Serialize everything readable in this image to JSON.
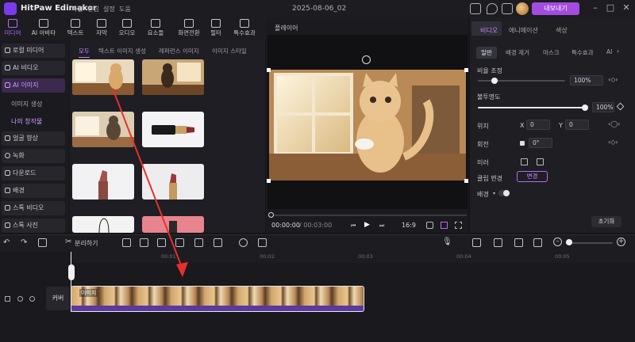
{
  "app": {
    "name": "HitPaw Edimakor",
    "project": "2025-08-06_02",
    "export_label": "내보내기"
  },
  "menu": [
    "파일",
    "편집",
    "설정",
    "도움"
  ],
  "toolbar": [
    {
      "label": "미디어",
      "icon": "media-icon",
      "active": true
    },
    {
      "label": "AI 아바타",
      "icon": "avatar-icon"
    },
    {
      "label": "텍스트",
      "icon": "text-icon"
    },
    {
      "label": "자막",
      "icon": "subtitle-icon"
    },
    {
      "label": "오디오",
      "icon": "audio-icon"
    },
    {
      "label": "요소들",
      "icon": "elements-icon"
    },
    {
      "label": "화면전환",
      "icon": "transition-icon"
    },
    {
      "label": "필터",
      "icon": "filter-icon"
    },
    {
      "label": "특수효과",
      "icon": "effects-icon"
    }
  ],
  "sidebar": {
    "items": [
      {
        "label": "로컬 미디어",
        "icon": "folder-icon"
      },
      {
        "label": "AI 비디오",
        "icon": "ai-video-icon"
      },
      {
        "label": "AI 이미지",
        "icon": "ai-image-icon",
        "active": true
      },
      {
        "label": "얼굴 향상",
        "icon": "face-icon"
      },
      {
        "label": "녹화",
        "icon": "record-icon"
      },
      {
        "label": "다운로드",
        "icon": "download-icon"
      },
      {
        "label": "배경",
        "icon": "background-icon"
      },
      {
        "label": "스톡 비디오",
        "icon": "stock-video-icon"
      },
      {
        "label": "스톡 사진",
        "icon": "stock-photo-icon"
      }
    ],
    "subitems": [
      "이미지 생성",
      "나의 창작물"
    ]
  },
  "media": {
    "tabs": [
      "모두",
      "텍스트 이미지 생성",
      "레퍼런스 이미지",
      "이미지 스타일"
    ]
  },
  "preview": {
    "title": "플레이어",
    "time_current": "00:00:00",
    "time_total": "/ 00:03:00",
    "ratio": "16:9"
  },
  "right": {
    "tabs": [
      "비디오",
      "애니메이션",
      "색상"
    ],
    "subtabs": [
      "일반",
      "배경 제거",
      "마스크",
      "특수효과",
      "AI"
    ],
    "scale_label": "비율 조정",
    "scale_value": "100%",
    "scale_level": 0.05,
    "opacity_label": "불투명도",
    "opacity_value": "100%",
    "opacity_level": 1.0,
    "position_label": "위치",
    "x_label": "X",
    "x_value": "0",
    "y_label": "Y",
    "y_value": "0",
    "rotate_label": "회전",
    "rotate_value": "0°",
    "flip_label": "미러",
    "bg_label": "클립 변경",
    "bg_button": "변경",
    "bg_toggle_label": "배경",
    "reset_label": "초기화"
  },
  "timeline": {
    "split_label": "분리하기",
    "ruler": [
      "00:01",
      "00:02",
      "00:03",
      "00:04",
      "00:05"
    ],
    "track_label": "커버",
    "clip_label": "이미지"
  }
}
